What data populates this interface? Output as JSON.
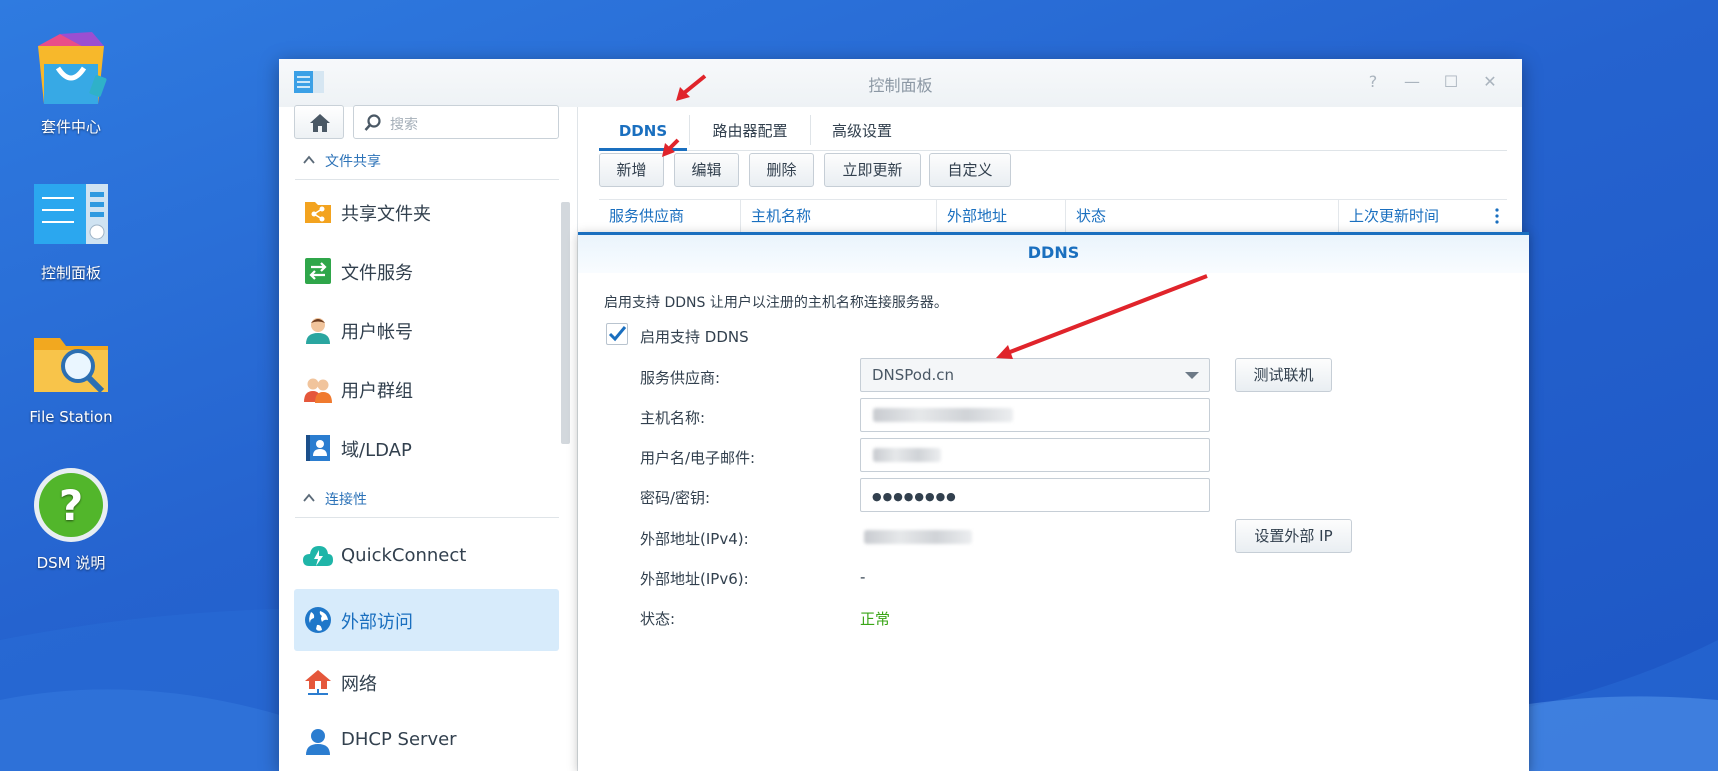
{
  "desktop": {
    "icons": [
      {
        "label": "套件中心",
        "icon": "package-center-icon"
      },
      {
        "label": "控制面板",
        "icon": "control-panel-icon"
      },
      {
        "label": "File Station",
        "icon": "file-station-icon"
      },
      {
        "label": "DSM 说明",
        "icon": "dsm-help-icon"
      }
    ]
  },
  "window": {
    "title": "控制面板",
    "controls": {
      "help": "?",
      "minimize": "—",
      "maximize": "☐",
      "close": "✕"
    }
  },
  "sidebar": {
    "search_placeholder": "搜索",
    "section_file_sharing": "文件共享",
    "section_connectivity": "连接性",
    "items": [
      {
        "label": "共享文件夹",
        "icon": "shared-folder-icon"
      },
      {
        "label": "文件服务",
        "icon": "file-services-icon"
      },
      {
        "label": "用户帐号",
        "icon": "user-icon"
      },
      {
        "label": "用户群组",
        "icon": "group-icon"
      },
      {
        "label": "域/LDAP",
        "icon": "ldap-icon"
      },
      {
        "label": "QuickConnect",
        "icon": "quickconnect-icon"
      },
      {
        "label": "外部访问",
        "icon": "globe-icon",
        "active": true
      },
      {
        "label": "网络",
        "icon": "network-icon"
      },
      {
        "label": "DHCP Server",
        "icon": "dhcp-icon"
      }
    ]
  },
  "tabs": [
    {
      "label": "DDNS",
      "active": true
    },
    {
      "label": "路由器配置"
    },
    {
      "label": "高级设置"
    }
  ],
  "toolbar": {
    "add": "新增",
    "edit": "编辑",
    "delete": "删除",
    "update_now": "立即更新",
    "customize": "自定义"
  },
  "table": {
    "columns": [
      "服务供应商",
      "主机名称",
      "外部地址",
      "状态",
      "上次更新时间"
    ]
  },
  "dialog": {
    "title": "DDNS",
    "description": "启用支持 DDNS 让用户以注册的主机名称连接服务器。",
    "enable_label": "启用支持 DDNS",
    "enable_checked": true,
    "provider_label": "服务供应商:",
    "provider_value": "DNSPod.cn",
    "test_button": "测试联机",
    "hostname_label": "主机名称:",
    "username_label": "用户名/电子邮件:",
    "password_label": "密码/密钥:",
    "password_value": "●●●●●●●●",
    "ipv4_label": "外部地址(IPv4):",
    "set_ip_button": "设置外部 IP",
    "ipv6_label": "外部地址(IPv6):",
    "ipv6_value": "-",
    "status_label": "状态:",
    "status_value": "正常"
  },
  "colors": {
    "accent": "#1a6fbf",
    "status_ok": "#3aa517",
    "annotation_arrow": "#e0242b",
    "desktop_bg": "#2563cf"
  }
}
